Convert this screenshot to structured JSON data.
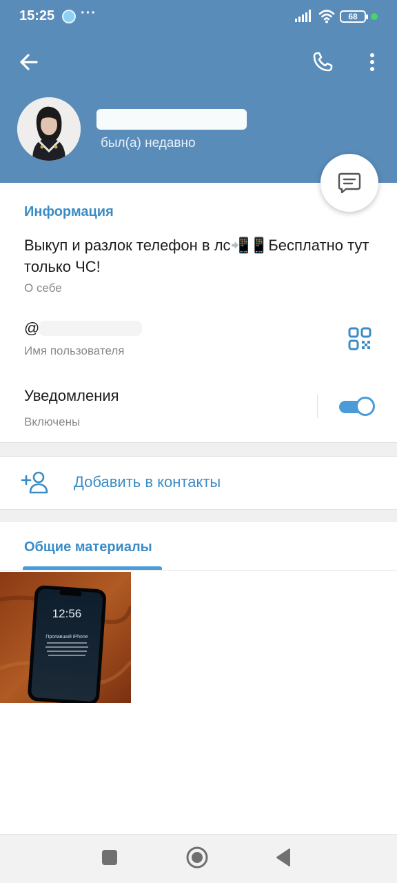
{
  "status_bar": {
    "time": "15:25",
    "overflow": "···",
    "battery": "68",
    "icons": [
      "app-notification-icon",
      "signal-icon",
      "wifi-icon",
      "battery-icon"
    ]
  },
  "toolbar": {
    "back_icon": "arrow-left-icon",
    "call_icon": "phone-icon",
    "more_icon": "more-vertical-icon"
  },
  "profile": {
    "last_seen": "был(а) недавно"
  },
  "colors": {
    "header_bg": "#5a8cba",
    "accent": "#3a8cc6",
    "toggle_on": "#4a9bd7"
  },
  "info": {
    "title": "Информация",
    "bio": "Выкуп и разлок телефон в лс📲📱Бесплатно тут только ЧС!",
    "bio_caption": "О себе",
    "username_prefix": "@",
    "username_caption": "Имя пользователя",
    "notifications_label": "Уведомления",
    "notifications_state": "Включены",
    "notifications_on": true
  },
  "actions": {
    "add_contact": "Добавить в контакты"
  },
  "media": {
    "title": "Общие материалы",
    "thumb_clock": "12:56",
    "thumb_title": "Пропавший iPhone"
  },
  "navbar": {
    "icons": [
      "recents-square-icon",
      "home-circle-icon",
      "back-triangle-icon"
    ]
  }
}
